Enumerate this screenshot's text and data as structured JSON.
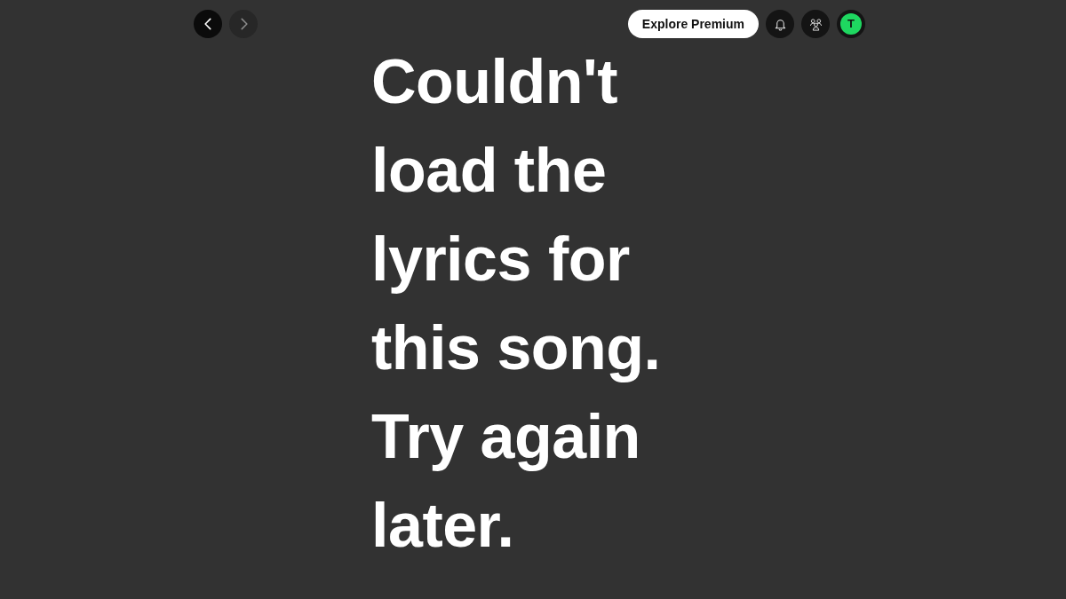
{
  "top_bar": {
    "nav_buttons": [
      {
        "kind": "back",
        "disabled": false
      },
      {
        "kind": "forward",
        "disabled": true
      }
    ],
    "premium_button": "Explore Premium",
    "avatar_initial": "T"
  },
  "lyrics": {
    "message": "Couldn't load the lyrics for this song. Try again later."
  }
}
